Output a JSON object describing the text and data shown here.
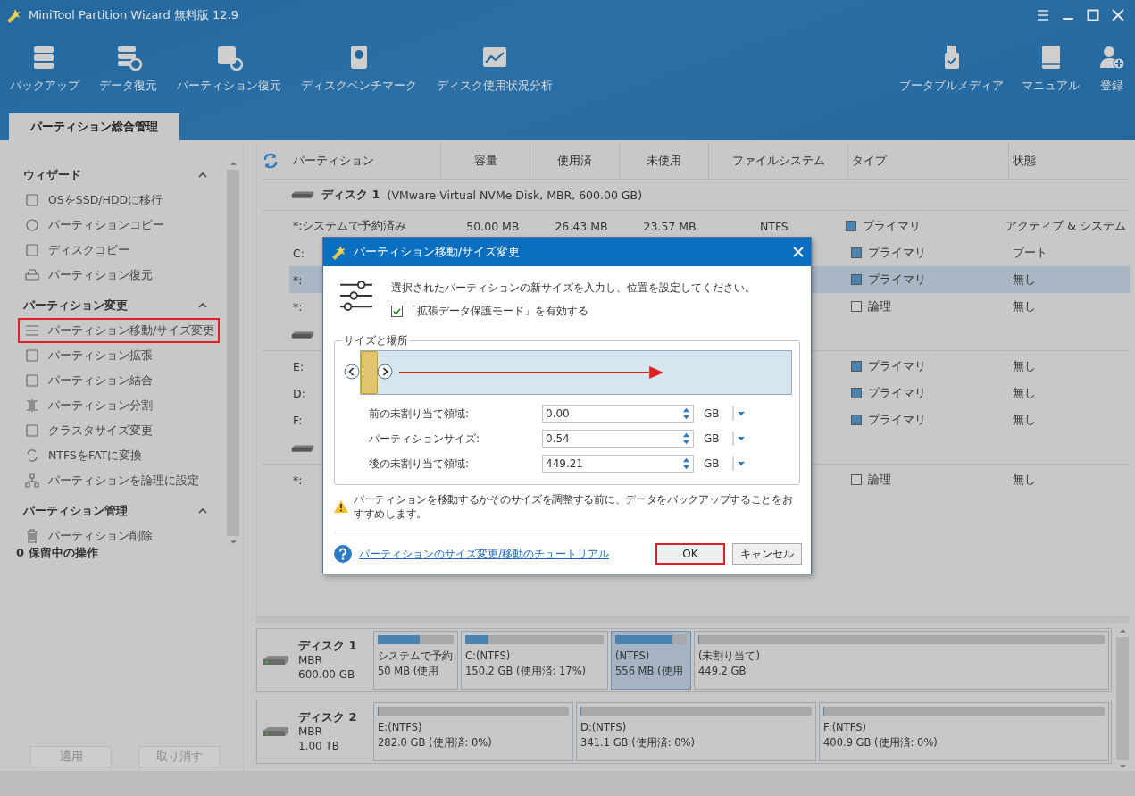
{
  "window": {
    "title": "MiniTool Partition Wizard 無料版 12.9"
  },
  "toolbar": {
    "left": [
      "バックアップ",
      "データ復元",
      "パーティション復元",
      "ディスクベンチマーク",
      "ディスク使用状況分析"
    ],
    "right": [
      "ブータブルメディア",
      "マニュアル",
      "登録"
    ]
  },
  "tabs": [
    {
      "label": "パーティション総合管理",
      "selected": true
    }
  ],
  "sidebar": {
    "sections": [
      {
        "title": "ウィザード",
        "expanded": true,
        "items": [
          {
            "label": "OSをSSD/HDDに移行",
            "highlighted": false
          },
          {
            "label": "パーティションコピー",
            "highlighted": false
          },
          {
            "label": "ディスクコピー",
            "highlighted": false
          },
          {
            "label": "パーティション復元",
            "highlighted": false
          }
        ]
      },
      {
        "title": "パーティション変更",
        "expanded": true,
        "items": [
          {
            "label": "パーティション移動/サイズ変更",
            "highlighted": true
          },
          {
            "label": "パーティション拡張",
            "highlighted": false
          },
          {
            "label": "パーティション結合",
            "highlighted": false
          },
          {
            "label": "パーティション分割",
            "highlighted": false
          },
          {
            "label": "クラスタサイズ変更",
            "highlighted": false
          },
          {
            "label": "NTFSをFATに変換",
            "highlighted": false
          },
          {
            "label": "パーティションを論理に設定",
            "highlighted": false
          }
        ]
      },
      {
        "title": "パーティション管理",
        "expanded": true,
        "items": [
          {
            "label": "パーティション削除",
            "highlighted": false
          }
        ]
      }
    ],
    "pending": "0 保留中の操作",
    "buttons": [
      {
        "label": "適用",
        "disabled": true
      },
      {
        "label": "取り消す",
        "disabled": true
      }
    ]
  },
  "table": {
    "columns": [
      "パーティション",
      "容量",
      "使用済",
      "未使用",
      "ファイルシステム",
      "タイプ",
      "状態"
    ],
    "disks": [
      {
        "name": "ディスク 1",
        "detail": "(VMware Virtual NVMe Disk, MBR, 600.00 GB)",
        "rows": [
          {
            "partition": "*:システムで予約済み",
            "capacity": "50.00 MB",
            "used": "26.43 MB",
            "unused": "23.57 MB",
            "file_system": "NTFS",
            "type": "プライマリ",
            "color": "#4a82b0",
            "status": "アクティブ & システム",
            "selected": false
          },
          {
            "partition": "C:",
            "type": "プライマリ",
            "color": "#4a82b0",
            "status": "ブート",
            "selected": false
          },
          {
            "partition": "*:",
            "type": "プライマリ",
            "color": "#4a82b0",
            "status": "無し",
            "selected": true
          },
          {
            "partition": "*:",
            "type": "論理",
            "color": "#cccccc",
            "status": "無し",
            "selected": false
          }
        ]
      },
      {
        "rows": [
          {
            "partition": "E:",
            "type": "プライマリ",
            "color": "#4a82b0",
            "status": "無し",
            "selected": false
          },
          {
            "partition": "D:",
            "type": "プライマリ",
            "color": "#4a82b0",
            "status": "無し",
            "selected": false
          },
          {
            "partition": "F:",
            "type": "プライマリ",
            "color": "#4a82b0",
            "status": "無し",
            "selected": false
          }
        ]
      },
      {
        "rows": [
          {
            "partition": "*:",
            "type": "論理",
            "color": "#cccccc",
            "status": "無し",
            "selected": false
          }
        ]
      }
    ]
  },
  "dialog": {
    "title": "パーティション移動/サイズ変更",
    "description": "選択されたパーティションの新サイズを入力し、位置を設定してください。",
    "protect_mode": {
      "label": "「拡張データ保護モード」を有効する",
      "checked": true
    },
    "group": "サイズと場所",
    "fields": [
      {
        "label": "前の未割り当て領域:",
        "value": "0.00",
        "unit": "GB"
      },
      {
        "label": "パーティションサイズ:",
        "value": "0.54",
        "unit": "GB"
      },
      {
        "label": "後の未割り当て領域:",
        "value": "449.21",
        "unit": "GB"
      }
    ],
    "warning": "パーティションを移動するかそのサイズを調整する前に、データをバックアップすることをおすすめします。",
    "help_link": "パーティションのサイズ変更/移動のチュートリアル",
    "buttons": [
      {
        "label": "OK",
        "highlighted": true
      },
      {
        "label": "キャンセル",
        "highlighted": false
      }
    ]
  },
  "disk_map": [
    {
      "name": "ディスク 1",
      "scheme": "MBR",
      "size": "600.00 GB",
      "partitions": [
        {
          "label": "システムで予約",
          "size": "50 MB (使用",
          "level": 0.55,
          "selected": false
        },
        {
          "label": "C:(NTFS)",
          "size": "150.2 GB (使用済: 17%)",
          "level": 0.17,
          "selected": false
        },
        {
          "label": "(NTFS)",
          "size": "556 MB (使用",
          "level": 0.8,
          "selected": true
        },
        {
          "label": "(未割り当て)",
          "size": "449.2 GB",
          "level": 0,
          "selected": false
        }
      ]
    },
    {
      "name": "ディスク 2",
      "scheme": "MBR",
      "size": "1.00 TB",
      "partitions": [
        {
          "label": "E:(NTFS)",
          "size": "282.0 GB (使用済: 0%)",
          "level": 0,
          "selected": false
        },
        {
          "label": "D:(NTFS)",
          "size": "341.1 GB (使用済: 0%)",
          "level": 0,
          "selected": false
        },
        {
          "label": "F:(NTFS)",
          "size": "400.9 GB (使用済: 0%)",
          "level": 0,
          "selected": false
        }
      ]
    }
  ]
}
